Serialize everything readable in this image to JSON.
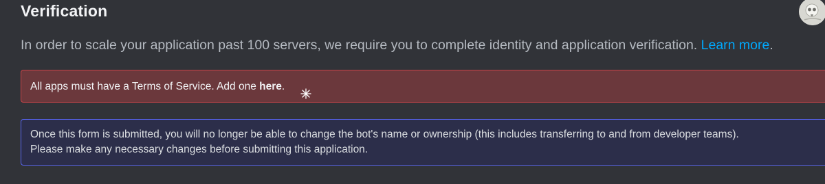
{
  "section": {
    "title": "Verification",
    "description": "In order to scale your application past 100 servers, we require you to complete identity and application verification.",
    "learn_more": "Learn more",
    "learn_more_suffix": "."
  },
  "error_banner": {
    "text_prefix": "All apps must have a Terms of Service. Add one ",
    "link": "here",
    "text_suffix": "."
  },
  "info_banner": {
    "line1": "Once this form is submitted, you will no longer be able to change the bot's name or ownership (this includes transferring to and from developer teams).",
    "line2": "Please make any necessary changes before submitting this application."
  },
  "colors": {
    "background": "#313338",
    "link": "#00a8fc",
    "error_bg": "#6b383c",
    "error_border": "#c74449",
    "info_border": "#5865f2"
  },
  "icons": {
    "avatar": "skull-avatar",
    "decoration": "sparkle-icon"
  }
}
